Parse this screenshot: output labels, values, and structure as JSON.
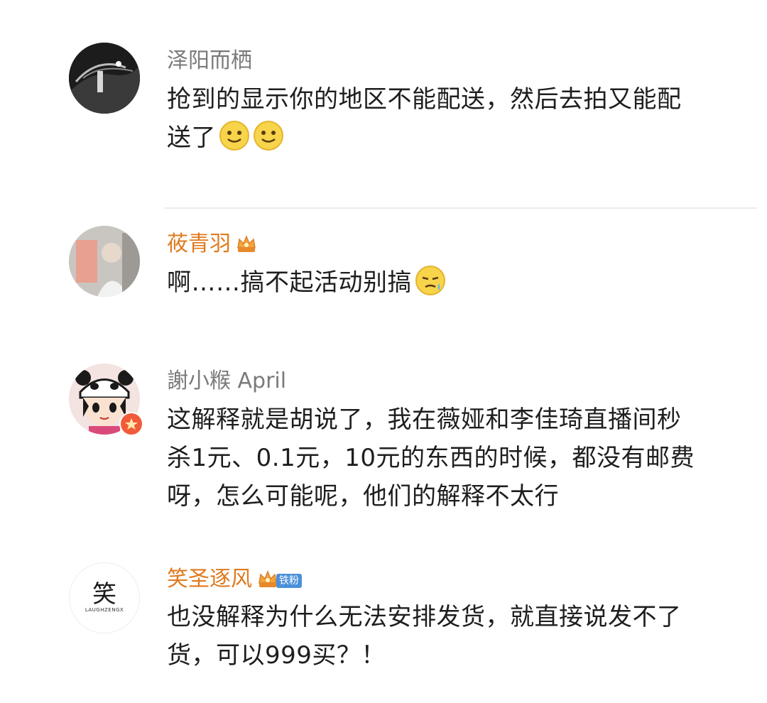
{
  "comments": [
    {
      "username": "泽阳而栖",
      "lines": [
        "抢到的显示你的地区不能配送，然后去拍又能配",
        "送了"
      ],
      "emoji": [
        "smile-emoji",
        "smile-emoji"
      ]
    },
    {
      "username": "莜青羽",
      "lines": [
        "啊……搞不起活动别搞"
      ],
      "badge": "crown-badge-icon",
      "emoji": [
        "sweat-emoji"
      ]
    },
    {
      "username": "謝小糇 April",
      "lines": [
        "这解释就是胡说了，我在薇娅和李佳琦直播间秒",
        "杀1元、0.1元，10元的东西的时候，都没有邮费",
        "呀，怎么可能呢，他们的解释不太行"
      ]
    },
    {
      "username": "笑圣逐风",
      "lines": [
        "也没解释为什么无法安排发货，就直接说发不了",
        "货，可以999买？！"
      ],
      "badge": "crown-badge-icon",
      "tag": "铁粉",
      "avatar_logo_text": "笑",
      "avatar_logo_caption": "LAUGHZENGX"
    }
  ],
  "colors": {
    "name_gray": "#7a7a7a",
    "name_orange": "#e07a1e",
    "divider": "#ececec"
  }
}
